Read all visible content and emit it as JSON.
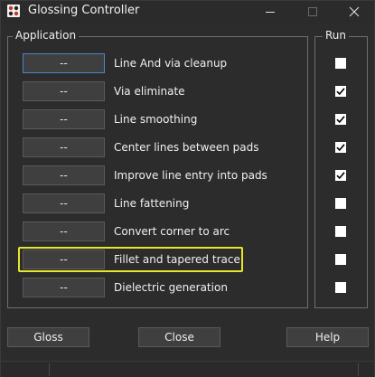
{
  "window": {
    "title": "Glossing Controller"
  },
  "application_group": {
    "title": "Application"
  },
  "run_group": {
    "title": "Run"
  },
  "rows": [
    {
      "button_label": "--",
      "label": "Line And via cleanup",
      "run": false,
      "focused": true
    },
    {
      "button_label": "--",
      "label": "Via eliminate",
      "run": true
    },
    {
      "button_label": "--",
      "label": "Line smoothing",
      "run": true
    },
    {
      "button_label": "--",
      "label": "Center lines between pads",
      "run": true
    },
    {
      "button_label": "--",
      "label": "Improve line entry into pads",
      "run": true
    },
    {
      "button_label": "--",
      "label": "Line fattening",
      "run": false
    },
    {
      "button_label": "--",
      "label": "Convert corner to arc",
      "run": false
    },
    {
      "button_label": "--",
      "label": "Fillet and tapered trace",
      "run": false,
      "highlighted": true
    },
    {
      "button_label": "--",
      "label": "Dielectric generation",
      "run": false
    }
  ],
  "buttons": {
    "gloss": "Gloss",
    "close": "Close",
    "help": "Help"
  },
  "colors": {
    "highlight": "#e6e62a",
    "focus": "#4a86c8"
  }
}
